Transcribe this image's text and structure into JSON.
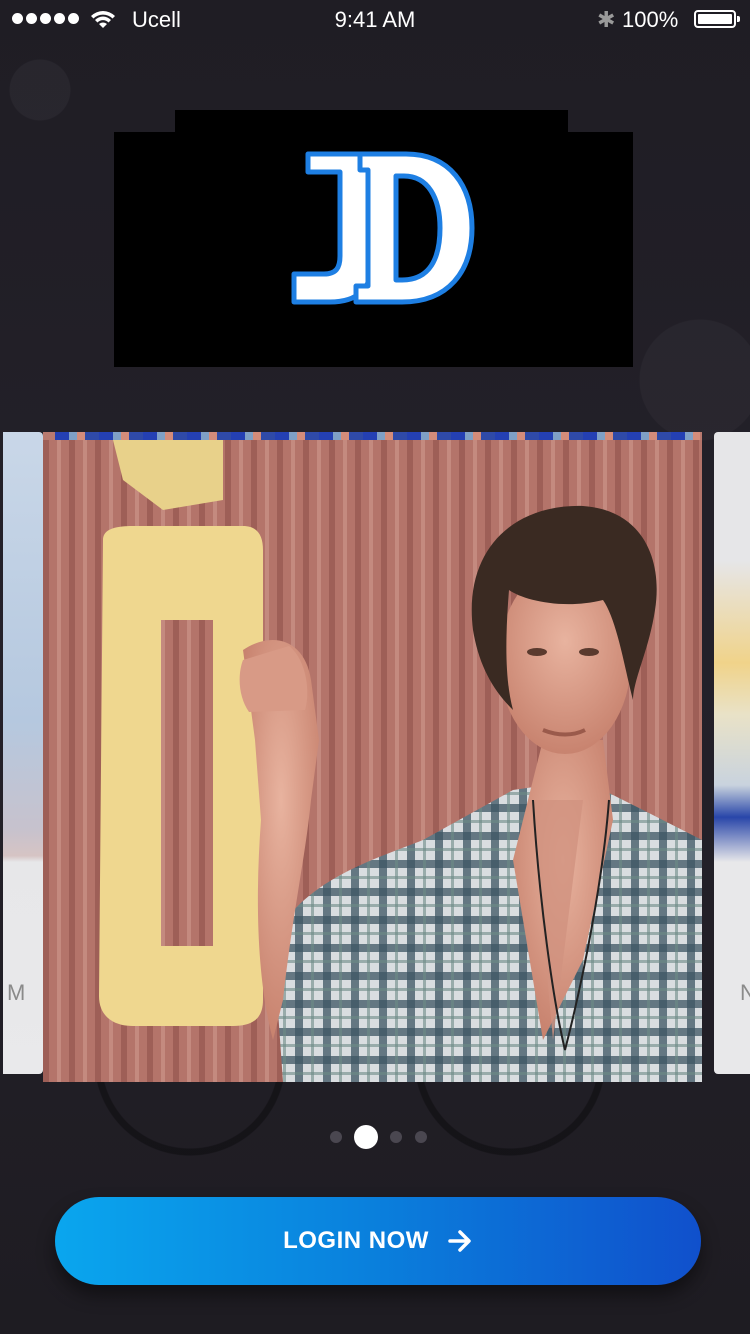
{
  "status_bar": {
    "carrier": "Ucell",
    "time": "9:41 AM",
    "battery": "100%",
    "icons": [
      "signal-dots-icon",
      "wifi-icon",
      "bluetooth-icon",
      "battery-icon"
    ]
  },
  "logo": {
    "text": "JD",
    "colors": {
      "fill": "#ffffff",
      "outline": "#1e7fe3",
      "background": "#000000"
    }
  },
  "carousel": {
    "side_left_letter": "M",
    "side_right_letter": "N",
    "active_index": 1,
    "dot_count": 4
  },
  "login": {
    "label": "LOGIN NOW",
    "icon": "arrow-right-icon",
    "gradient": [
      "#0aa6ee",
      "#0a7fdc",
      "#1050cc"
    ]
  }
}
